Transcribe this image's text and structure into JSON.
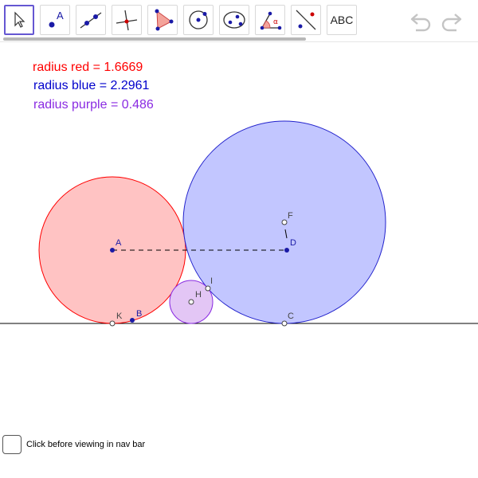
{
  "toolbar": {
    "tools": [
      {
        "name": "move-tool",
        "icon": "pointer-arrow-icon"
      },
      {
        "name": "point-tool",
        "icon": "point-icon",
        "letter": "A"
      },
      {
        "name": "line-tool",
        "icon": "line-through-points-icon"
      },
      {
        "name": "perpendicular-line-tool",
        "icon": "perpendicular-line-icon"
      },
      {
        "name": "polygon-tool",
        "icon": "polygon-icon"
      },
      {
        "name": "circle-center-point-tool",
        "icon": "circle-center-point-icon"
      },
      {
        "name": "conic-tool",
        "icon": "ellipse-icon"
      },
      {
        "name": "angle-tool",
        "icon": "angle-icon",
        "letter": "α"
      },
      {
        "name": "reflect-tool",
        "icon": "reflect-about-line-icon"
      },
      {
        "name": "text-tool",
        "icon": "text-icon",
        "label": "ABC"
      }
    ],
    "selected": "move-tool",
    "undo_icon": "undo-icon",
    "redo_icon": "redo-icon"
  },
  "labels": {
    "radius_red": "radius red = 1.6669",
    "radius_blue": "radius blue = 2.2961",
    "radius_purple": "radius purple = 0.486"
  },
  "points": {
    "A": "A",
    "B": "B",
    "C": "C",
    "D": "D",
    "F": "F",
    "H": "H",
    "I": "I",
    "K": "K"
  },
  "colors": {
    "red_label": "#ff0000",
    "blue_label": "#0000cc",
    "purple_label": "#8a2be2",
    "red_fill": "#ffc3c3",
    "red_stroke": "#ff0000",
    "blue_fill": "#bfc3ff",
    "blue_stroke": "#2222cc",
    "purple_fill": "#e3c6f5",
    "purple_stroke": "#8a2be2",
    "accent": "#6557d2"
  },
  "checkbox": {
    "label": "Click before viewing in nav bar",
    "checked": false
  }
}
